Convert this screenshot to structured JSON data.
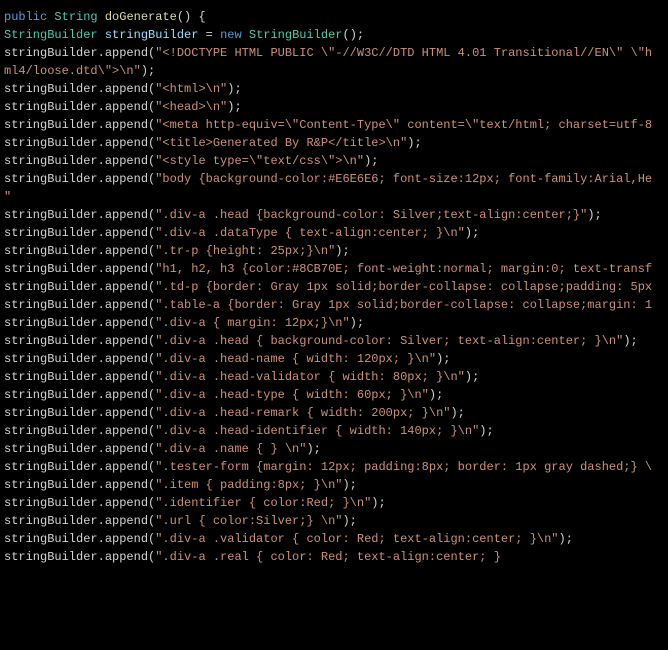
{
  "code": {
    "lines": [
      {
        "id": 1,
        "html": "<span class='kw-public'>public</span> <span class='kw-string'>String</span> <span class='method'>doGenerate</span><span class='plain'>() {</span>"
      },
      {
        "id": 2,
        "html": "<span class='plain'>    </span><span class='class-name'>StringBuilder</span> <span class='identifier'>stringBuilder</span><span class='plain'> = </span><span class='kw-new'>new</span> <span class='class-name'>StringBuilder</span><span class='plain'>();</span>"
      },
      {
        "id": 3,
        "html": "<span class='plain'>    stringBuilder.append(</span><span class='string-literal'>\"&lt;!DOCTYPE HTML PUBLIC \\\"-//W3C//DTD HTML 4.01 Transitional//EN\\\" \\\"h</span>"
      },
      {
        "id": 4,
        "html": "<span class='plain'>                </span><span class='string-literal'>ml4/loose.dtd\\\"&gt;\\n\"</span><span class='plain'>);</span>"
      },
      {
        "id": 5,
        "html": "<span class='plain'>    stringBuilder.append(</span><span class='string-literal'>\"&lt;html&gt;\\n\"</span><span class='plain'>);</span>"
      },
      {
        "id": 6,
        "html": "<span class='plain'>    stringBuilder.append(</span><span class='string-literal'>\"&lt;head&gt;\\n\"</span><span class='plain'>);</span>"
      },
      {
        "id": 7,
        "html": "<span class='plain'>    stringBuilder.append(</span><span class='string-literal'>\"&lt;meta http-equiv=\\\"Content-Type\\\" content=\\\"text/html; charset=utf-8</span>"
      },
      {
        "id": 8,
        "html": "<span class='plain'>    stringBuilder.append(</span><span class='string-literal'>\"&lt;title&gt;Generated By R&amp;P&lt;/title&gt;\\n\"</span><span class='plain'>);</span>"
      },
      {
        "id": 9,
        "html": "<span class='plain'>    stringBuilder.append(</span><span class='string-literal'>\"&lt;style type=\\\"text/css\\\"&gt;\\n\"</span><span class='plain'>);</span>"
      },
      {
        "id": 10,
        "html": "<span class='plain'>    stringBuilder.append(</span><span class='string-literal'>\"body {background-color:#E6E6E6; font-size:12px; font-family:Arial,He</span>"
      },
      {
        "id": 11,
        "html": "<span class='plain'>                </span><span class='string-literal'>\"</span>"
      },
      {
        "id": 12,
        "html": "<span class='plain'>    stringBuilder.append(</span><span class='string-literal'>\".div-a .head {background-color: Silver;text-align:center;}\"</span><span class='plain'>);</span>"
      },
      {
        "id": 13,
        "html": "<span class='plain'>    stringBuilder.append(</span><span class='string-literal'>\".div-a .dataType { text-align:center; }\\n\"</span><span class='plain'>);</span>"
      },
      {
        "id": 14,
        "html": "<span class='plain'>    stringBuilder.append(</span><span class='string-literal'>\".tr-p {height: 25px;}\\n\"</span><span class='plain'>);</span>"
      },
      {
        "id": 15,
        "html": "<span class='plain'>    stringBuilder.append(</span><span class='string-literal'>\"h1, h2, h3 {color:#8CB70E; font-weight:normal; margin:0; text-transf</span>"
      },
      {
        "id": 16,
        "html": "<span class='plain'>    stringBuilder.append(</span><span class='string-literal'>\".td-p {border: Gray 1px solid;border-collapse: collapse;padding: 5px</span>"
      },
      {
        "id": 17,
        "html": "<span class='plain'>    stringBuilder.append(</span><span class='string-literal'>\".table-a {border: Gray 1px solid;border-collapse: collapse;margin: 1</span>"
      },
      {
        "id": 18,
        "html": "<span class='plain'>    stringBuilder.append(</span><span class='string-literal'>\".div-a { margin: 12px;}\\n\"</span><span class='plain'>);</span>"
      },
      {
        "id": 19,
        "html": "<span class='plain'>    stringBuilder.append(</span><span class='string-literal'>\".div-a .head { background-color: Silver; text-align:center; }\\n\"</span><span class='plain'>);</span>"
      },
      {
        "id": 20,
        "html": "<span class='plain'>    stringBuilder.append(</span><span class='string-literal'>\".div-a .head-name { width: 120px; }\\n\"</span><span class='plain'>);</span>"
      },
      {
        "id": 21,
        "html": "<span class='plain'>    stringBuilder.append(</span><span class='string-literal'>\".div-a .head-validator { width: 80px; }\\n\"</span><span class='plain'>);</span>"
      },
      {
        "id": 22,
        "html": "<span class='plain'>    stringBuilder.append(</span><span class='string-literal'>\".div-a .head-type { width: 60px; }\\n\"</span><span class='plain'>);</span>"
      },
      {
        "id": 23,
        "html": "<span class='plain'>    stringBuilder.append(</span><span class='string-literal'>\".div-a .head-remark { width: 200px; }\\n\"</span><span class='plain'>);</span>"
      },
      {
        "id": 24,
        "html": "<span class='plain'>    stringBuilder.append(</span><span class='string-literal'>\".div-a .head-identifier { width: 140px; }\\n\"</span><span class='plain'>);</span>"
      },
      {
        "id": 25,
        "html": "<span class='plain'>    stringBuilder.append(</span><span class='string-literal'>\".div-a .name { } \\n\"</span><span class='plain'>);</span>"
      },
      {
        "id": 26,
        "html": "<span class='plain'>    stringBuilder.append(</span><span class='string-literal'>\".tester-form {margin: 12px; padding:8px; border: 1px gray dashed;} \\</span>"
      },
      {
        "id": 27,
        "html": "<span class='plain'>    stringBuilder.append(</span><span class='string-literal'>\".item { padding:8px; }\\n\"</span><span class='plain'>);</span>"
      },
      {
        "id": 28,
        "html": "<span class='plain'>    stringBuilder.append(</span><span class='string-literal'>\".identifier { color:Red; }\\n\"</span><span class='plain'>);</span>"
      },
      {
        "id": 29,
        "html": "<span class='plain'>    stringBuilder.append(</span><span class='string-literal'>\".url { color:Silver;} \\n\"</span><span class='plain'>);</span>"
      },
      {
        "id": 30,
        "html": "<span class='plain'>    stringBuilder.append(</span><span class='string-literal'>\".div-a .validator { color: Red; text-align:center; }\\n\"</span><span class='plain'>);</span>"
      },
      {
        "id": 31,
        "html": "<span class='plain'>    stringBuilder.append(</span><span class='string-literal'>\".div-a .real { color: Red; text-align:center; }</span>"
      }
    ]
  }
}
